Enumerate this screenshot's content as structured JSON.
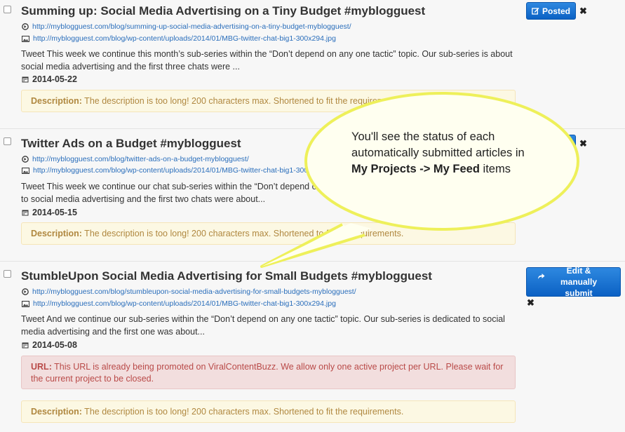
{
  "items": [
    {
      "title": "Summing up: Social Media Advertising on a Tiny Budget #myblogguest",
      "url": "http://myblogguest.com/blog/summing-up-social-media-advertising-on-a-tiny-budget-myblogguest/",
      "image_url": "http://myblogguest.com/blog/wp-content/uploads/2014/01/MBG-twitter-chat-big1-300x294.jpg",
      "body": "Tweet This week we continue this month’s sub-series within the “Don’t depend on any one tactic” topic. Our sub-series is about social media advertising and the first three chats were ...",
      "date": "2014-05-22",
      "description_label": "Description:",
      "description_text": " The description is too long! 200 characters max. Shortened to fit the requirements.",
      "button_label": "Posted"
    },
    {
      "title": "Twitter Ads on a Budget #myblogguest",
      "url": "http://myblogguest.com/blog/twitter-ads-on-a-budget-myblogguest/",
      "image_url": "http://myblogguest.com/blog/wp-content/uploads/2014/01/MBG-twitter-chat-big1-300x294.jpg",
      "body": "Tweet This week we continue our chat sub-series within the “Don’t depend on any one tactic” topic. Our sub-series is dedicated to social media advertising and the first two chats were about...",
      "date": "2014-05-15",
      "description_label": "Description:",
      "description_text": " The description is too long! 200 characters max. Shortened to fit the requirements."
    },
    {
      "title": "StumbleUpon Social Media Advertising for Small Budgets #myblogguest",
      "url": "http://myblogguest.com/blog/stumbleupon-social-media-advertising-for-small-budgets-myblogguest/",
      "image_url": "http://myblogguest.com/blog/wp-content/uploads/2014/01/MBG-twitter-chat-big1-300x294.jpg",
      "body": "Tweet And we continue our sub-series within the “Don’t depend on any one tactic” topic. Our sub-series is dedicated to social media advertising and the first one was about...",
      "date": "2014-05-08",
      "url_error_label": "URL:",
      "url_error_text": " This URL is already being promoted on ViralContentBuzz. We allow only one active project per URL. Please wait for the current project to be closed.",
      "description_label": "Description:",
      "description_text": " The description is too long! 200 characters max. Shortened to fit the requirements.",
      "button_label": "Edit & manually submit"
    }
  ],
  "callout": {
    "line1": "You'll see the status of each automatically submitted articles in ",
    "bold": "My Projects -> My Feed",
    "line2": " items"
  },
  "close_glyph": "✖",
  "colors": {
    "accent_blue": "#1a73d6",
    "callout_fill": "#fffff0",
    "callout_stroke": "#eef05a"
  }
}
